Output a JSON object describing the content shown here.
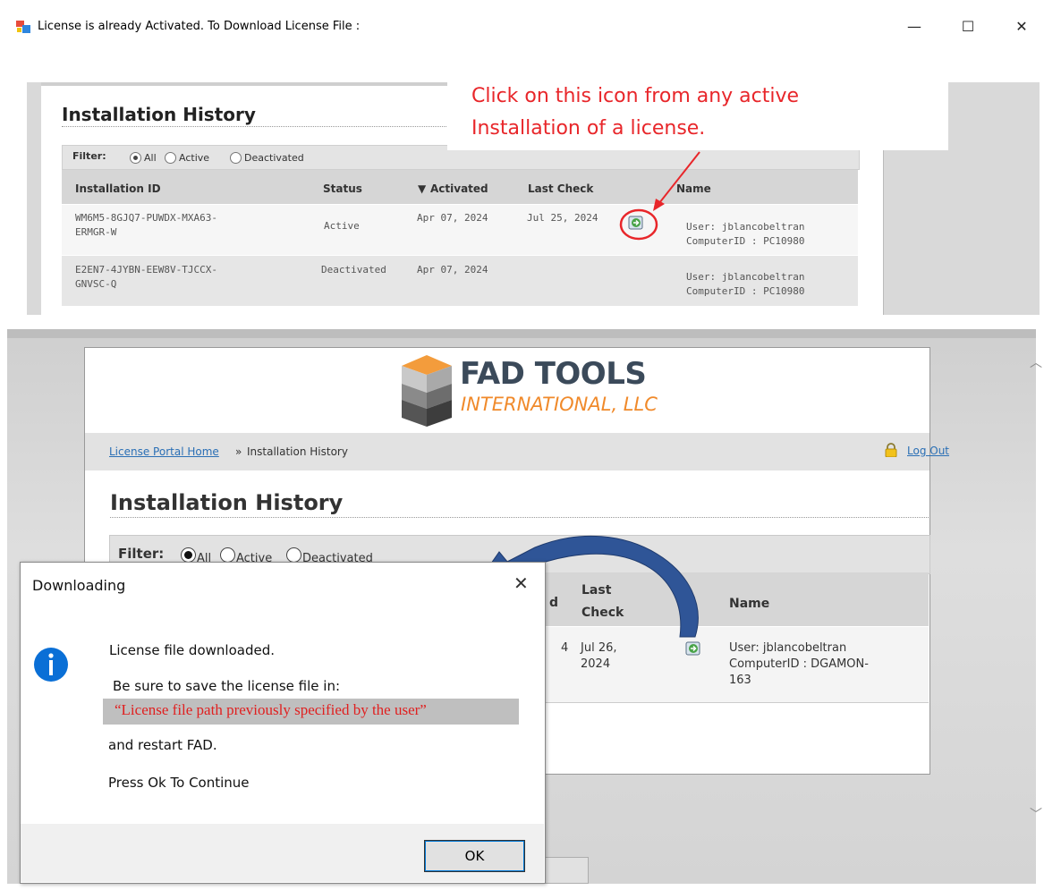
{
  "window": {
    "title": "License is already Activated. To Download License File :",
    "controls": [
      "minimize",
      "maximize",
      "close"
    ]
  },
  "callout": {
    "line1": "Click on this icon from any active",
    "line2": "Installation of a license.",
    "color": "#e8262a"
  },
  "top_screenshot": {
    "heading": "Installation History",
    "filter_label": "Filter:",
    "filter_options": [
      "All",
      "Active",
      "Deactivated"
    ],
    "columns": [
      "Installation ID",
      "Status",
      "Activated",
      "Last Check",
      "Name"
    ],
    "rows": [
      {
        "id_line1": "WM6M5-8GJQ7-PUWDX-MXA63-",
        "id_line2": "ERMGR-W",
        "status": "Active",
        "activated": "Apr 07, 2024",
        "last_check": "Jul 25, 2024",
        "name_line1": "User: jblancobeltran",
        "name_line2": "ComputerID : PC10980"
      },
      {
        "id_line1": "E2EN7-4JYBN-EEW8V-TJCCX-",
        "id_line2": "GNVSC-Q",
        "status": "Deactivated",
        "activated": "Apr 07, 2024",
        "last_check": "",
        "name_line1": "User: jblancobeltran",
        "name_line2": "ComputerID : PC10980"
      }
    ]
  },
  "portal": {
    "logo_title": "FAD TOOLS",
    "logo_subtitle": "INTERNATIONAL, LLC",
    "breadcrumb_home": "License Portal Home",
    "breadcrumb_sep": "»",
    "breadcrumb_current": "Installation History",
    "logout": "Log Out",
    "heading": "Installation History",
    "filter_label": "Filter:",
    "filter_options": [
      "All",
      "Active",
      "Deactivated"
    ],
    "columns_visible": {
      "activated_tail": "d",
      "last_check_l1": "Last",
      "last_check_l2": "Check",
      "name": "Name"
    },
    "row": {
      "activated_tail": "4",
      "last_check_l1": "Jul 26,",
      "last_check_l2": "2024",
      "name_line1": "User: jblancobeltran",
      "name_line2": "ComputerID : DGAMON-",
      "name_line3": "163"
    }
  },
  "dialog": {
    "title": "Downloading",
    "message1": "License file downloaded.",
    "message2": "Be sure to save the license file in:",
    "path_text": "“License file path previously specified by the user”",
    "message3": "and restart FAD.",
    "message4": "Press Ok To Continue",
    "ok_label": "OK"
  },
  "icons": {
    "app": "app-window-icon",
    "download": "download-license-icon",
    "info": "info-icon",
    "lock": "lock-icon"
  },
  "colors": {
    "accent_blue": "#2f5597",
    "link_blue": "#2a6fb5",
    "info_blue": "#0a6fd6",
    "logo_orange": "#f08a2b"
  }
}
